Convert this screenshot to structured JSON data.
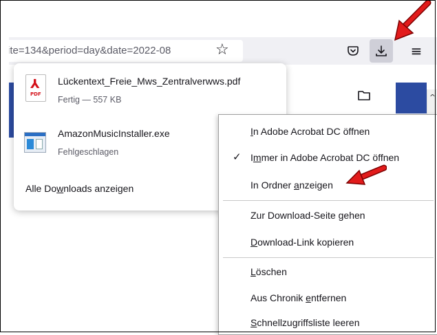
{
  "toolbar": {
    "url_text": "ite=134&period=day&date=2022-08",
    "bookmark_icon": "star-icon",
    "pocket_icon": "pocket-icon",
    "downloads_icon": "download-icon",
    "menu_icon": "hamburger-icon"
  },
  "downloads_panel": {
    "items": [
      {
        "file_name": "Lückentext_Freie_Mws_Zentralverwws.pdf",
        "status": "Fertig — 557 KB",
        "icon": "pdf-file-icon",
        "icon_label": "PDF"
      },
      {
        "file_name": "AmazonMusicInstaller.exe",
        "status": "Fehlgeschlagen",
        "icon": "exe-file-icon"
      }
    ],
    "show_all": {
      "pre": "Alle Do",
      "accel": "w",
      "post": "nloads anzeigen"
    }
  },
  "context_menu": {
    "items": [
      {
        "accel": "I",
        "rest": "n Adobe Acrobat DC öffnen"
      },
      {
        "pre": "I",
        "accel": "m",
        "rest": "mer in Adobe Acrobat DC öffnen",
        "checked": true
      },
      {
        "pre": "In Ordner ",
        "accel": "a",
        "rest": "nzeigen"
      },
      {
        "pre": "Zur Download-Seite ",
        "accel": "g",
        "rest": "ehen"
      },
      {
        "accel": "D",
        "rest": "ownload-Link kopieren"
      },
      {
        "accel": "L",
        "rest": "öschen"
      },
      {
        "pre": "Aus Chronik ",
        "accel": "e",
        "rest": "ntfernen"
      },
      {
        "accel": "S",
        "rest": "chnellzugriffsliste leeren"
      }
    ]
  },
  "colors": {
    "accent_blue": "#2c4ba1",
    "arrow_red": "#e21b1b",
    "toolbar_bg": "#f0f0f4"
  }
}
